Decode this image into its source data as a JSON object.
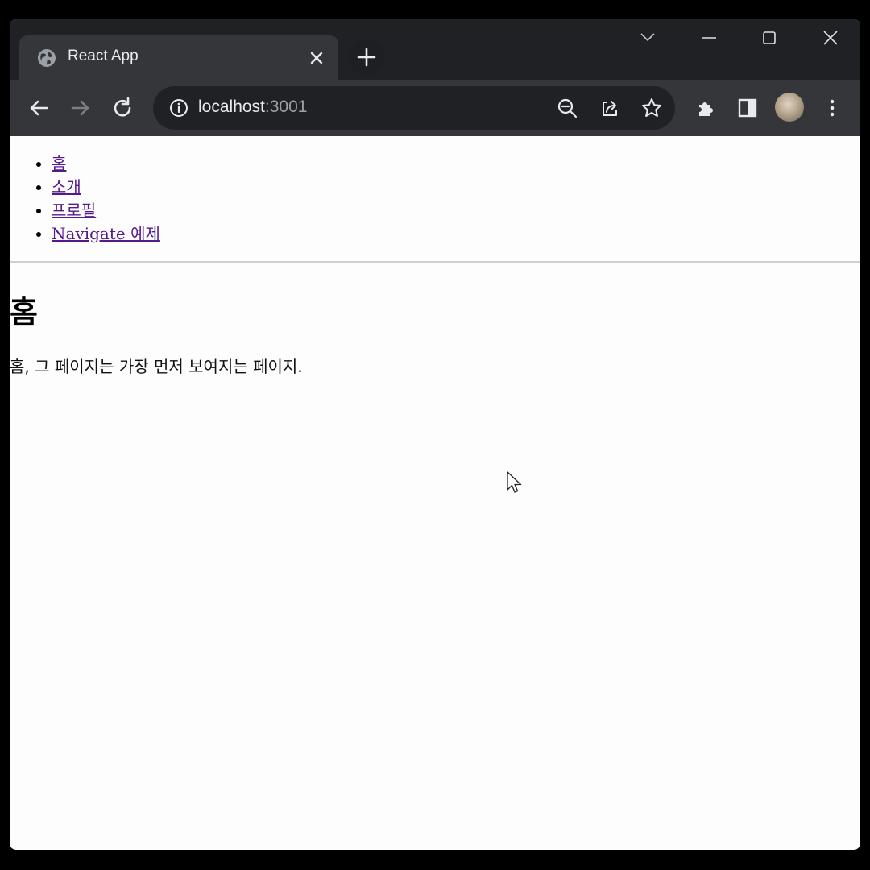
{
  "browser": {
    "tab": {
      "title": "React App",
      "favicon": "globe-icon",
      "close_icon": "close-icon"
    },
    "new_tab_icon": "plus-icon",
    "window_controls": [
      "chevron-down-icon",
      "minimize-icon",
      "maximize-icon",
      "close-icon"
    ],
    "address_bar": {
      "host": "localhost",
      "port": ":3001",
      "info_icon": "info-icon"
    },
    "address_bar_icons": [
      "zoom-out-icon",
      "share-icon",
      "star-icon"
    ],
    "toolbar_icons": [
      "back-icon",
      "forward-icon",
      "reload-icon",
      "extensions-icon",
      "side-panel-icon",
      "profile-avatar",
      "menu-icon"
    ]
  },
  "nav": {
    "links": [
      {
        "label": "홈"
      },
      {
        "label": "소개"
      },
      {
        "label": "프로필"
      },
      {
        "label": "Navigate 예제"
      }
    ]
  },
  "page": {
    "title": "홈",
    "description": "홈, 그 페이지는 가장 먼저 보여지는 페이지."
  },
  "colors": {
    "titlebar": "#202124",
    "toolbar": "#35363a",
    "link": "#551a8b",
    "page_bg": "#fdfdfd"
  }
}
